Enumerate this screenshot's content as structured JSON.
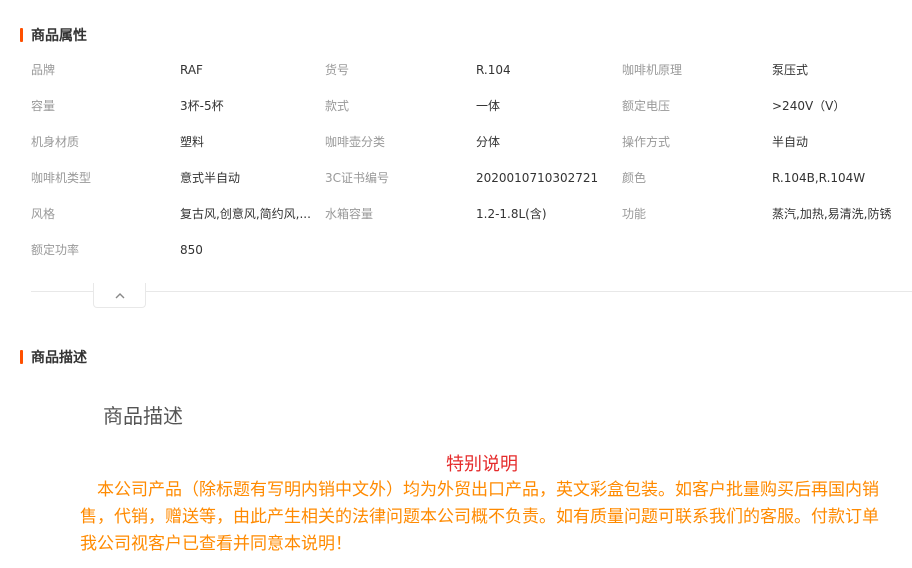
{
  "attributes_section": {
    "title": "商品属性",
    "rows": [
      [
        {
          "key": "品牌",
          "value": "RAF"
        },
        {
          "key": "货号",
          "value": "R.104"
        },
        {
          "key": "咖啡机原理",
          "value": "泵压式"
        }
      ],
      [
        {
          "key": "容量",
          "value": "3杯-5杯"
        },
        {
          "key": "款式",
          "value": "一体"
        },
        {
          "key": "额定电压",
          "value": ">240V（V）"
        }
      ],
      [
        {
          "key": "机身材质",
          "value": "塑料"
        },
        {
          "key": "咖啡壶分类",
          "value": "分体"
        },
        {
          "key": "操作方式",
          "value": "半自动"
        }
      ],
      [
        {
          "key": "咖啡机类型",
          "value": "意式半自动"
        },
        {
          "key": "3C证书编号",
          "value": "2020010710302721"
        },
        {
          "key": "颜色",
          "value": "R.104B,R.104W"
        }
      ],
      [
        {
          "key": "风格",
          "value": "复古风,创意风,简约风,..."
        },
        {
          "key": "水箱容量",
          "value": "1.2-1.8L(含)"
        },
        {
          "key": "功能",
          "value": "蒸汽,加热,易清洗,防锈"
        }
      ],
      [
        {
          "key": "额定功率",
          "value": "850"
        }
      ]
    ]
  },
  "description_section": {
    "title": "商品描述",
    "heading": "商品描述",
    "notice_title": "特别说明",
    "notice_body": "　本公司产品（除标题有写明内销中文外）均为外贸出口产品，英文彩盒包装。如客户批量购买后再国内销售，代销，赠送等，由此产生相关的法律问题本公司概不负责。如有质量问题可联系我们的客服。付款订单我公司视客户已查看并同意本说明！"
  },
  "colors": {
    "accent": "#ff5000",
    "notice_title": "#e52b2b",
    "notice_body": "#ff8a00"
  },
  "icons": {
    "collapse": "chevron-up-icon"
  }
}
